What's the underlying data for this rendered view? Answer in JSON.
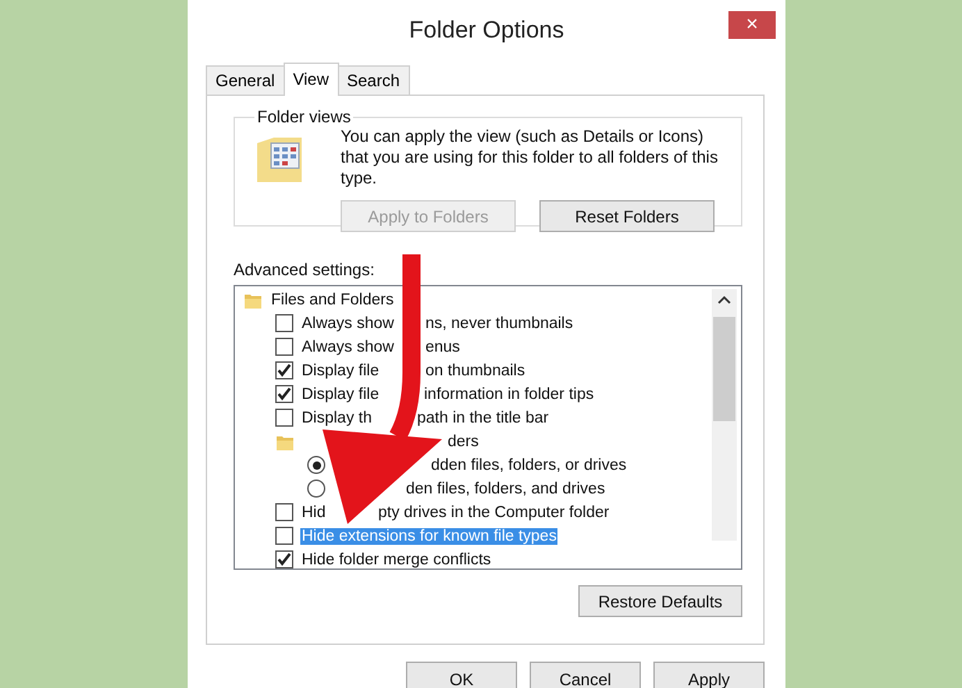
{
  "window": {
    "title": "Folder Options",
    "close": "×"
  },
  "tabs": [
    {
      "label": "General",
      "selected": false
    },
    {
      "label": "View",
      "selected": true
    },
    {
      "label": "Search",
      "selected": false
    }
  ],
  "folder_views": {
    "title": "Folder views",
    "text": "You can apply the view (such as Details or Icons) that you are using for this folder to all folders of this type.",
    "buttons": [
      {
        "label": "Apply to Folders",
        "disabled": true
      },
      {
        "label": "Reset Folders",
        "disabled": false
      }
    ]
  },
  "advanced": {
    "label": "Advanced settings:",
    "items": [
      {
        "kind": "folder",
        "label_parts": [
          "Files and Folders"
        ],
        "selected": false,
        "children": [
          {
            "kind": "checkbox",
            "label_parts": [
              "Always show",
              "ns, never thumbnails"
            ],
            "checked": false,
            "selected": false
          },
          {
            "kind": "checkbox",
            "label_parts": [
              "Always show",
              "enus"
            ],
            "checked": false,
            "selected": false
          },
          {
            "kind": "checkbox",
            "label_parts": [
              "Display file",
              "on thumbnails"
            ],
            "checked": true,
            "selected": false
          },
          {
            "kind": "checkbox",
            "label_parts": [
              "Display file",
              "information in folder tips"
            ],
            "checked": true,
            "selected": false
          },
          {
            "kind": "checkbox",
            "label_parts": [
              "Display th",
              "path in the title bar"
            ],
            "checked": false,
            "selected": false
          },
          {
            "kind": "folder",
            "label_parts": [
              "ders"
            ],
            "selected": false,
            "children": [
              {
                "kind": "radio",
                "label_parts": [
                  "dden files, folders, or drives"
                ],
                "checked": true,
                "selected": false
              },
              {
                "kind": "radio",
                "label_parts": [
                  "den files, folders, and drives"
                ],
                "checked": false,
                "selected": false
              }
            ]
          },
          {
            "kind": "checkbox",
            "label_parts": [
              "Hid",
              "pty drives in the Computer folder"
            ],
            "checked": false,
            "selected": false
          },
          {
            "kind": "checkbox",
            "label_parts": [
              "Hide extensions for known file types"
            ],
            "checked": false,
            "selected": true
          },
          {
            "kind": "checkbox",
            "label_parts": [
              "Hide folder merge conflicts"
            ],
            "checked": true,
            "selected": false
          }
        ]
      }
    ],
    "restore_button": "Restore Defaults"
  },
  "dialog_buttons": [
    "OK",
    "Cancel",
    "Apply"
  ]
}
